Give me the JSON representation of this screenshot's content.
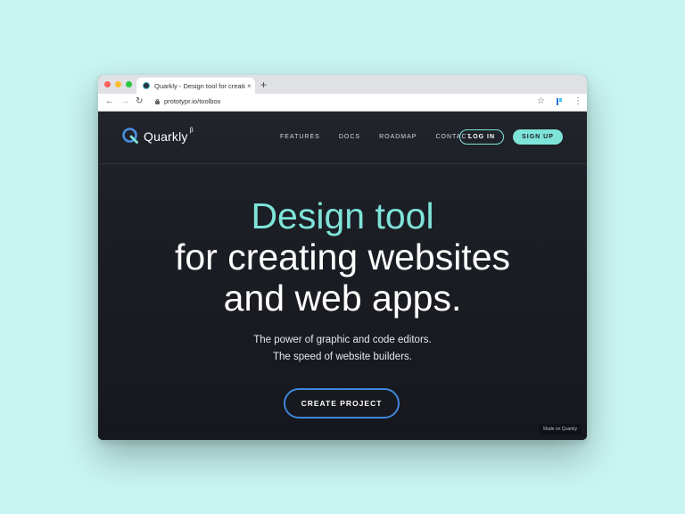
{
  "browser": {
    "tab_title": "Quarkly - Design tool for creating",
    "tab_close": "×",
    "new_tab": "+",
    "back": "←",
    "forward": "→",
    "reload": "↻",
    "url": "prototypr.io/toolbox",
    "bookmark": "☆",
    "menu": "⋮"
  },
  "site": {
    "logo_text": "Quarkly",
    "logo_beta": "β",
    "nav": [
      "FEATURES",
      "DOCS",
      "ROADMAP",
      "CONTACT"
    ],
    "login_label": "LOG IN",
    "signup_label": "SIGN UP",
    "hero_line1": "Design tool",
    "hero_line2": "for creating websites",
    "hero_line3": "and web apps.",
    "sub_line1": "The power of graphic and code editors.",
    "sub_line2": "The speed of website builders.",
    "cta_label": "CREATE PROJECT",
    "made_on": "Made on Quarkly"
  },
  "colors": {
    "background": "#c8f4f1",
    "accent": "#7ee3d8",
    "cta_border": "#3f86d9",
    "site_bg": "#1b1d24"
  },
  "icons": [
    "quarkly-logo-icon",
    "lock-icon",
    "star-icon",
    "extension-icon",
    "kebab-menu-icon"
  ]
}
